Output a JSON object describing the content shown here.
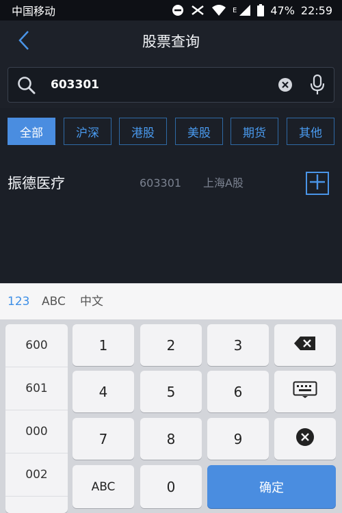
{
  "status_bar": {
    "carrier": "中国移动",
    "network": "E",
    "battery": "47%",
    "time": "22:59"
  },
  "nav": {
    "title": "股票查询",
    "back_icon": "chevron-left-icon"
  },
  "search": {
    "value": "603301",
    "icons": [
      "search-icon",
      "clear-icon",
      "microphone-icon"
    ]
  },
  "tabs": [
    {
      "label": "全部",
      "active": true
    },
    {
      "label": "沪深",
      "active": false
    },
    {
      "label": "港股",
      "active": false
    },
    {
      "label": "美股",
      "active": false
    },
    {
      "label": "期货",
      "active": false
    },
    {
      "label": "其他",
      "active": false
    }
  ],
  "results": [
    {
      "name": "振德医疗",
      "code": "603301",
      "market": "上海A股"
    }
  ],
  "keyboard": {
    "modes": [
      "123",
      "ABC",
      "中文"
    ],
    "active_mode": "123",
    "prefixes": [
      "600",
      "601",
      "000",
      "002"
    ],
    "keys": {
      "k1": "1",
      "k2": "2",
      "k3": "3",
      "k4": "4",
      "k5": "5",
      "k6": "6",
      "k7": "7",
      "k8": "8",
      "k9": "9",
      "abc": "ABC",
      "k0": "0",
      "confirm": "确定"
    }
  },
  "colors": {
    "accent": "#4a8de0",
    "background": "#1b1f27",
    "tab_border": "#2f6aa6"
  }
}
